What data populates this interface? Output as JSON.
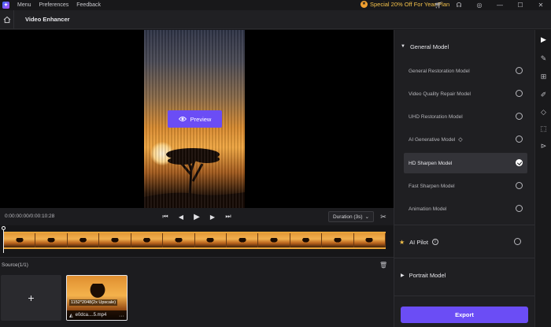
{
  "titlebar": {
    "menu": [
      "Menu",
      "Preferences",
      "Feedback"
    ],
    "promo": "Special 20% Off For Year Plan",
    "icons": [
      "cart-icon",
      "headset-icon",
      "account-icon",
      "minimize-icon",
      "maximize-icon",
      "close-icon"
    ]
  },
  "header": {
    "title": "Video Enhancer"
  },
  "preview": {
    "button_label": "Preview"
  },
  "controls": {
    "timecode": "0:00:00:00/0:00:10:28",
    "duration_label": "Duration (3s)"
  },
  "source": {
    "label": "Source(1/1)",
    "clip": {
      "resolution": "1152*2048(2x Upscale)",
      "filename": "e0dca....5.mp4"
    }
  },
  "panel": {
    "general_model_title": "General Model",
    "models": [
      {
        "label": "General Restoration Model",
        "selected": false
      },
      {
        "label": "Video Quality Repair Model",
        "selected": false
      },
      {
        "label": "UHD Restoration Model",
        "selected": false
      },
      {
        "label": "AI Generative Model",
        "selected": false
      },
      {
        "label": "HD Sharpen Model",
        "selected": true
      },
      {
        "label": "Fast Sharpen Model",
        "selected": false
      },
      {
        "label": "Animation Model",
        "selected": false
      }
    ],
    "ai_pilot": "AI Pilot",
    "portrait_model": "Portrait Model",
    "export_label": "Export"
  },
  "accent_color": "#6b4df5"
}
